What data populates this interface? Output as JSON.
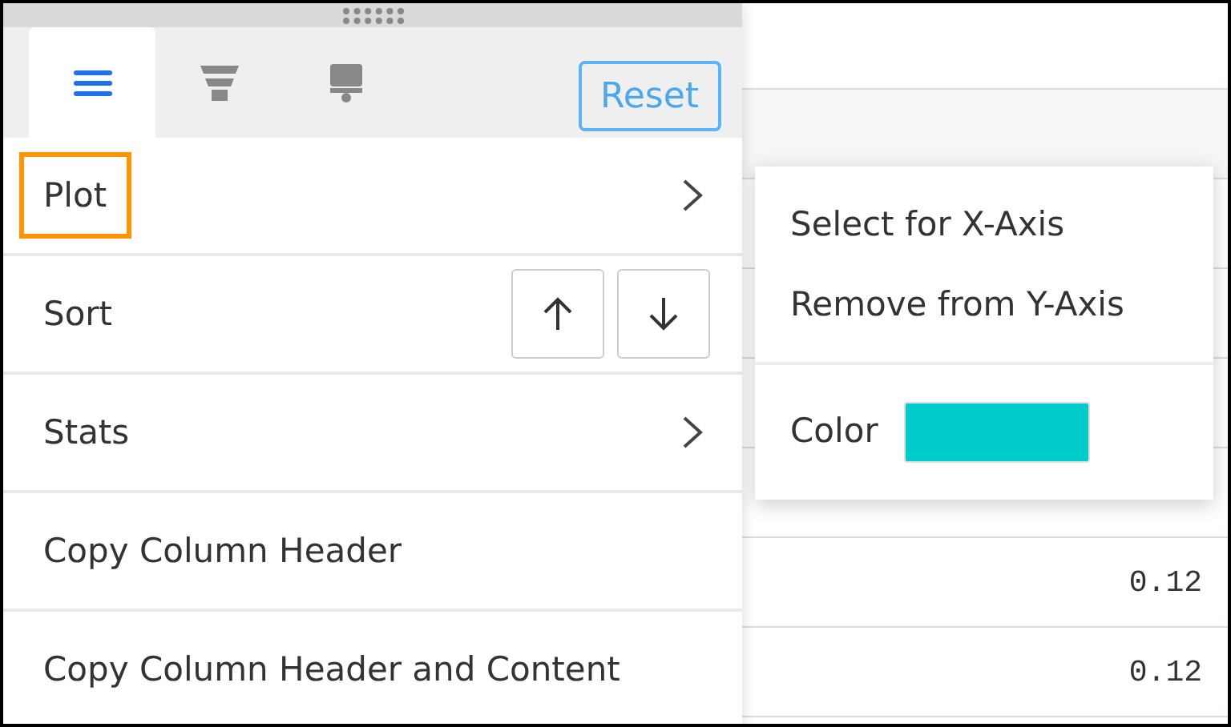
{
  "table": {
    "rows": [
      {
        "value": "0.12"
      },
      {
        "value": "0.12"
      }
    ]
  },
  "panel": {
    "tabs": [
      {
        "kind": "menu",
        "selected": true
      },
      {
        "kind": "filter",
        "selected": false
      },
      {
        "kind": "brush",
        "selected": false
      }
    ],
    "reset_button": "Reset",
    "items": [
      {
        "kind": "submenu",
        "label": "Plot",
        "focused": true
      },
      {
        "kind": "sort",
        "label": "Sort",
        "focused": false
      },
      {
        "kind": "submenu",
        "label": "Stats",
        "focused": false
      },
      {
        "kind": "plain",
        "label": "Copy Column Header",
        "focused": false
      },
      {
        "kind": "plain",
        "label": "Copy Column Header and Content",
        "focused": false
      }
    ]
  },
  "submenu": {
    "items": [
      "Select for X-Axis",
      "Remove from Y-Axis"
    ],
    "color_label": "Color",
    "color": "#00cccc"
  }
}
